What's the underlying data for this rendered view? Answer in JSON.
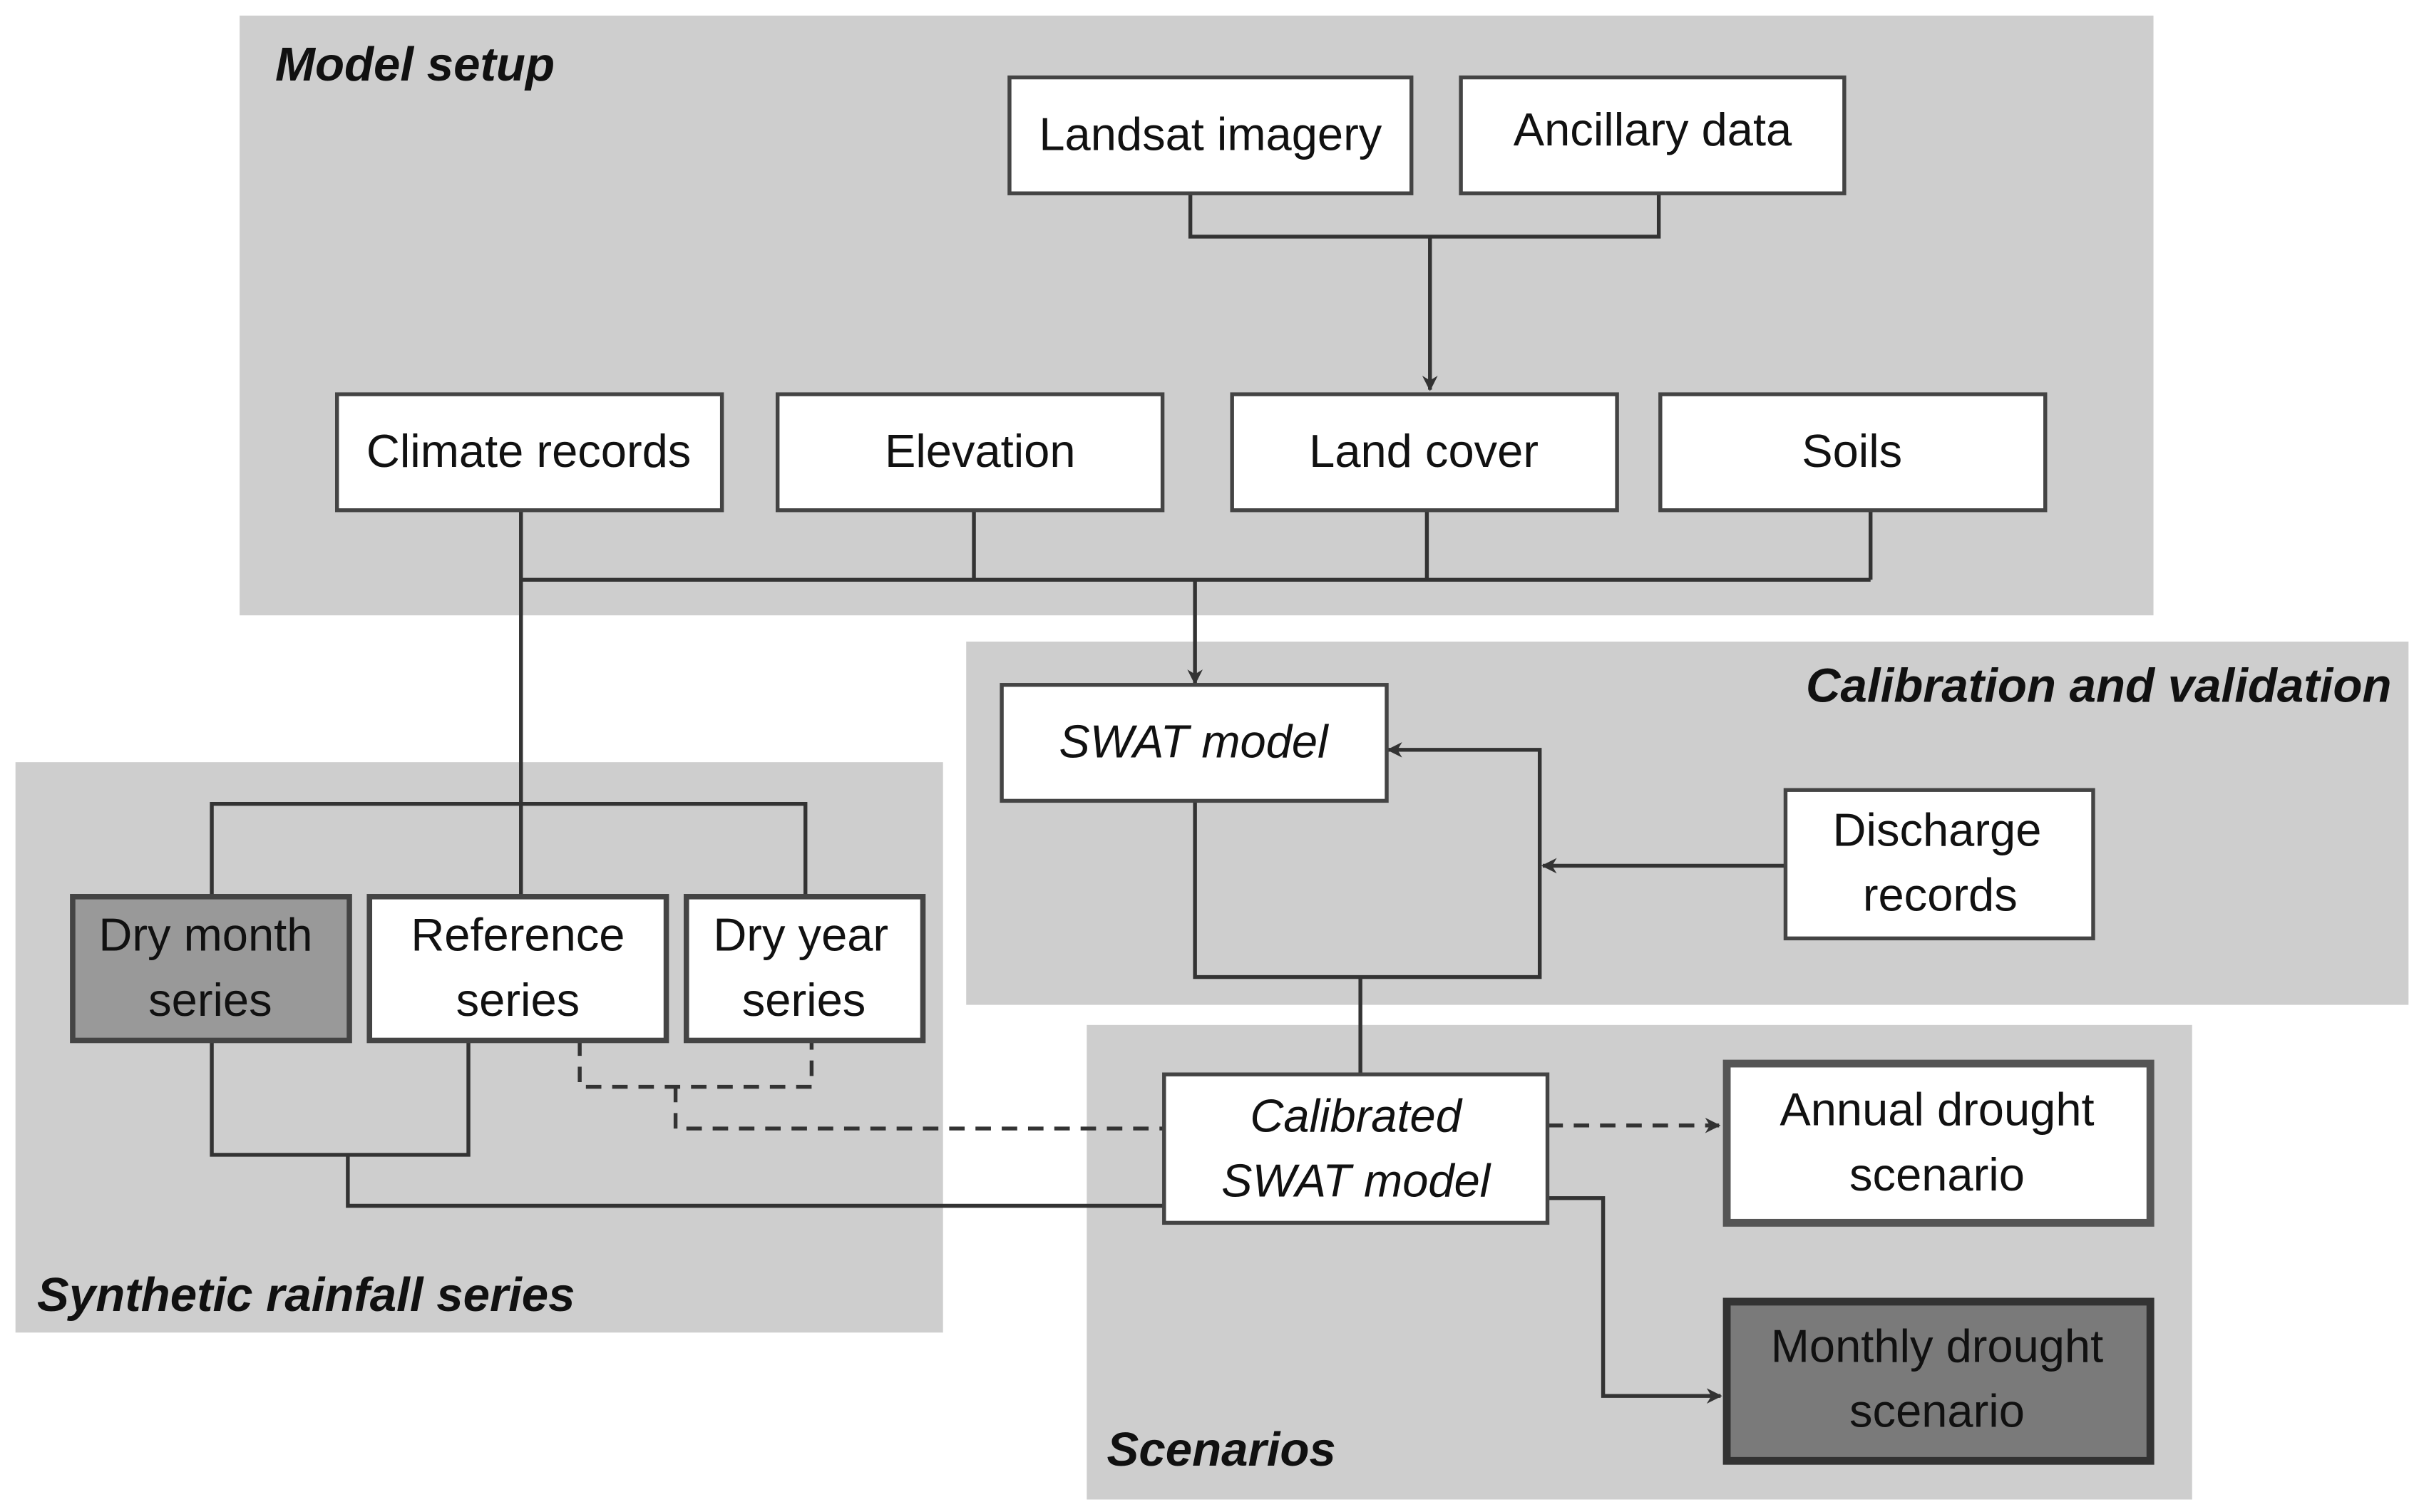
{
  "panels": {
    "model_setup": "Model setup",
    "calibration": "Calibration and validation",
    "synthetic": "Synthetic rainfall series",
    "scenarios": "Scenarios"
  },
  "boxes": {
    "landsat": "Landsat imagery",
    "ancillary": "Ancillary data",
    "climate": "Climate records",
    "elevation": "Elevation",
    "land_cover": "Land cover",
    "soils": "Soils",
    "swat": "SWAT model",
    "discharge": [
      "Discharge",
      "records"
    ],
    "dry_month": [
      "Dry month",
      "series"
    ],
    "reference": [
      "Reference",
      "series"
    ],
    "dry_year": [
      "Dry year",
      "series"
    ],
    "calibrated": [
      "Calibrated",
      "SWAT model"
    ],
    "annual": [
      "Annual drought",
      "scenario"
    ],
    "monthly": [
      "Monthly drought",
      "scenario"
    ]
  },
  "colors": {
    "panel": "#cecece",
    "dry_month_fill": "#999999",
    "monthly_fill": "#7a7a7a",
    "line": "#333333"
  }
}
